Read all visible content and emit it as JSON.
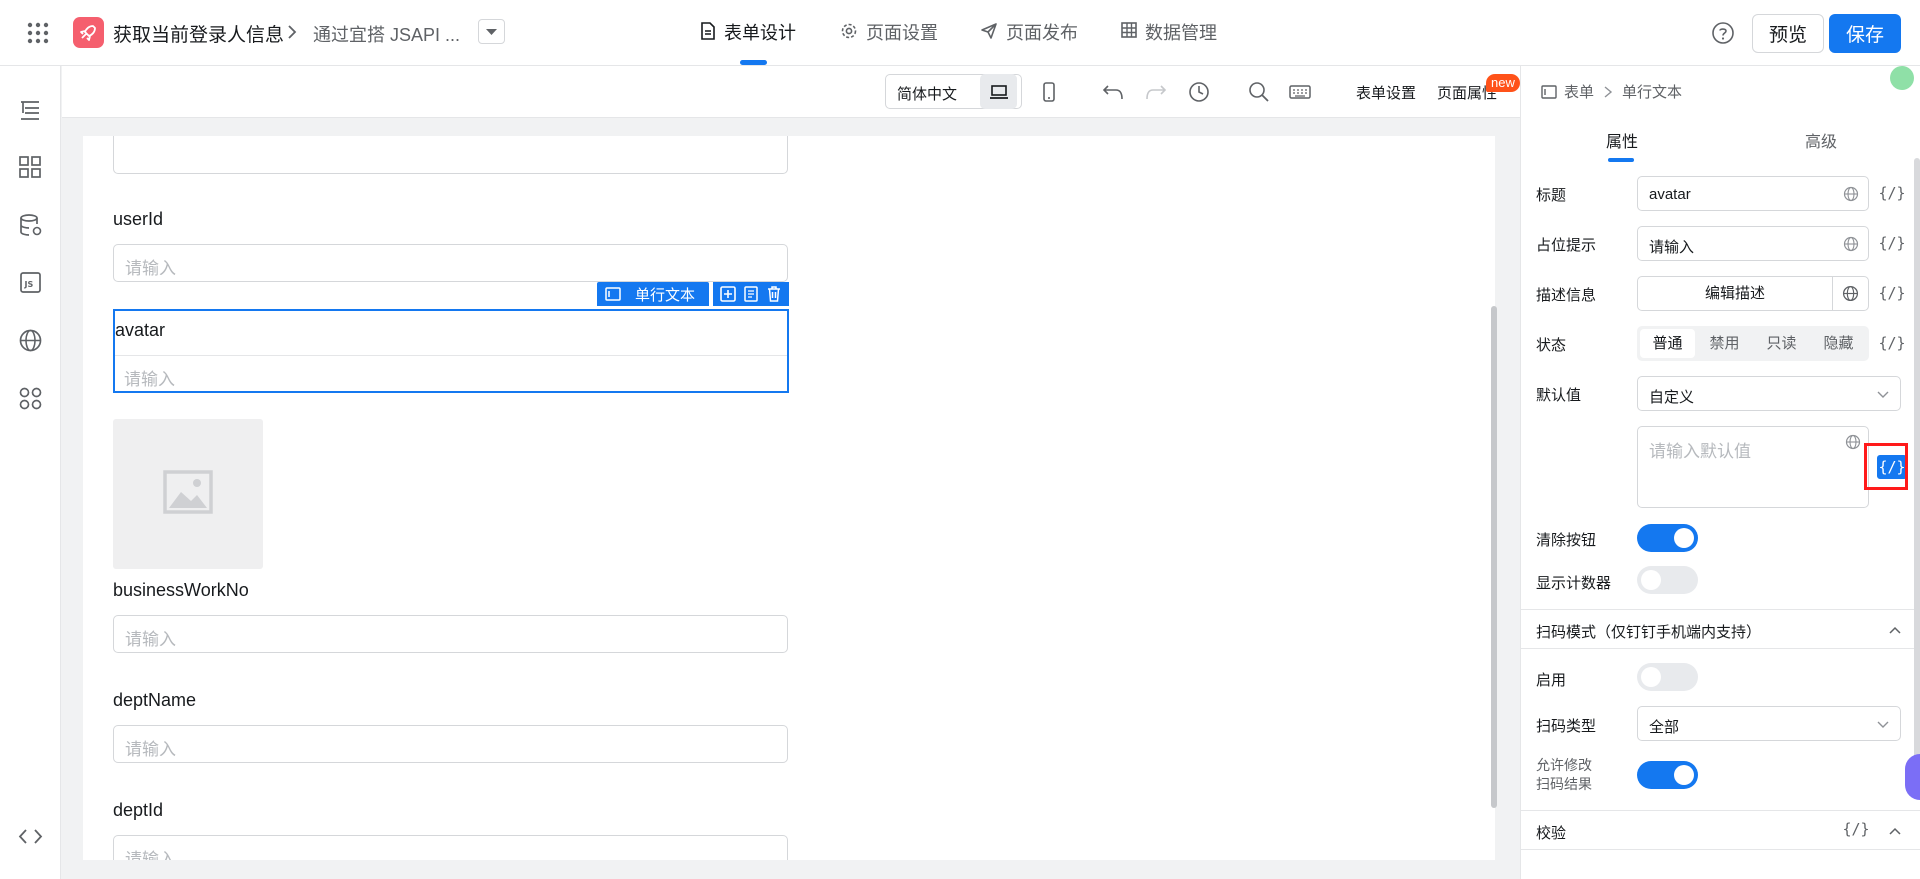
{
  "header": {
    "app_title": "获取当前登录人信息",
    "page_name": "通过宜搭 JSAPI ...",
    "tabs": [
      {
        "label": "表单设计",
        "icon": "file-icon",
        "active": true
      },
      {
        "label": "页面设置",
        "icon": "gear-icon",
        "active": false
      },
      {
        "label": "页面发布",
        "icon": "paper-plane-icon",
        "active": false
      },
      {
        "label": "数据管理",
        "icon": "table-icon",
        "active": false
      }
    ],
    "preview_label": "预览",
    "save_label": "保存",
    "accent_color": "#1478f0"
  },
  "toolbar": {
    "language": "简体中文",
    "form_settings": "表单设置",
    "page_props": "页面属性",
    "new_badge": "new"
  },
  "canvas": {
    "fields": [
      {
        "label": "userId",
        "placeholder": "请输入"
      },
      {
        "label": "avatar",
        "placeholder": "请输入"
      },
      {
        "label": "businessWorkNo",
        "placeholder": "请输入"
      },
      {
        "label": "deptName",
        "placeholder": "请输入"
      },
      {
        "label": "deptId",
        "placeholder": "请输入"
      }
    ],
    "selected_tag": "单行文本"
  },
  "panel": {
    "breadcrumb_form": "表单",
    "breadcrumb_component": "单行文本",
    "tab_props": "属性",
    "tab_advanced": "高级",
    "title_label": "标题",
    "title_value": "avatar",
    "placeholder_label": "占位提示",
    "placeholder_value": "请输入",
    "desc_label": "描述信息",
    "desc_button": "编辑描述",
    "status_label": "状态",
    "status_options": [
      "普通",
      "禁用",
      "只读",
      "隐藏"
    ],
    "status_selected": "普通",
    "default_label": "默认值",
    "default_mode": "自定义",
    "default_placeholder": "请输入默认值",
    "clear_label": "清除按钮",
    "clear_on": true,
    "counter_label": "显示计数器",
    "counter_on": false,
    "scan_section": "扫码模式（仅钉钉手机端内支持）",
    "scan_enable_label": "启用",
    "scan_enable_on": false,
    "scan_type_label": "扫码类型",
    "scan_type_value": "全部",
    "scan_modify_label_1": "允许修改",
    "scan_modify_label_2": "扫码结果",
    "scan_modify_on": true,
    "validate_section": "校验",
    "expr_symbol": "{/}"
  }
}
